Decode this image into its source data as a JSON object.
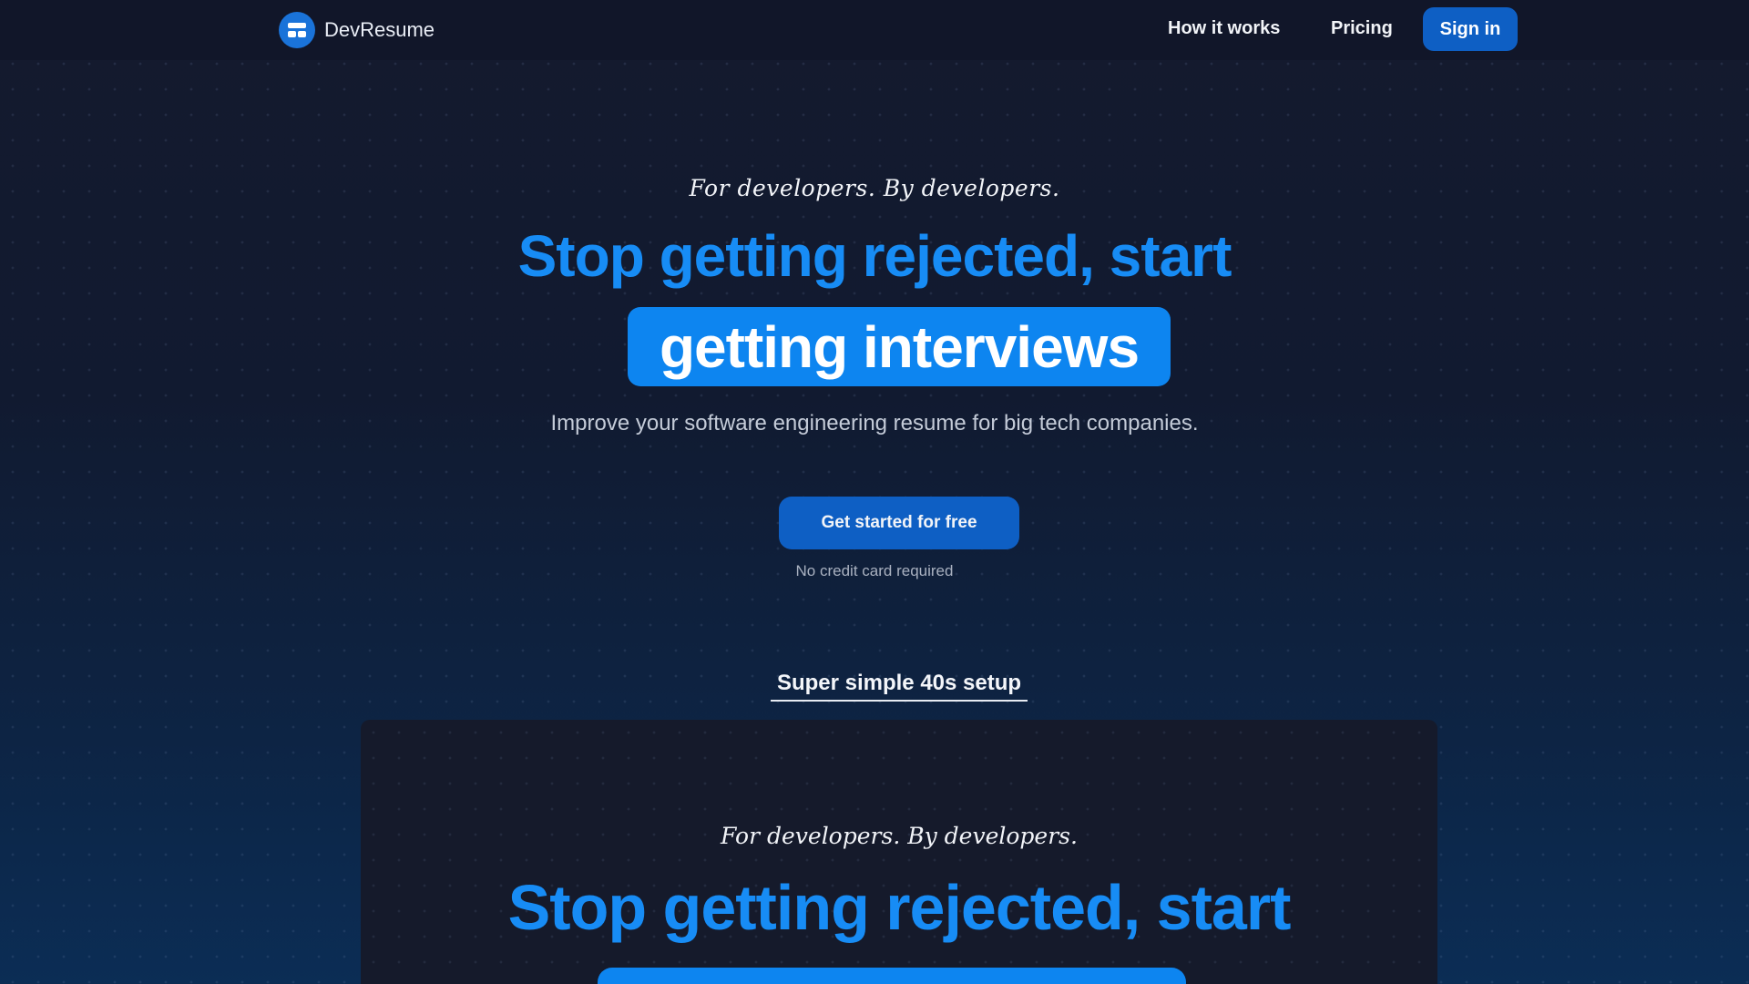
{
  "nav": {
    "brand": "DevResume",
    "links": [
      "How it works",
      "Pricing"
    ],
    "signin": "Sign in"
  },
  "hero": {
    "tagline": "For developers. By developers.",
    "headline_line1": "Stop getting rejected, start",
    "headline_line2": "getting interviews",
    "subtitle": "Improve your software engineering resume for big tech companies.",
    "cta": "Get started for free",
    "cta_note": "No credit card required"
  },
  "setup": {
    "title": "Super simple 40s setup"
  },
  "preview": {
    "tagline": "For developers. By developers.",
    "headline_line1": "Stop getting rejected, start"
  },
  "colors": {
    "accent": "#178cf5",
    "button": "#0e5fc4",
    "highlight": "#0d85f0",
    "background": "#111a30"
  }
}
